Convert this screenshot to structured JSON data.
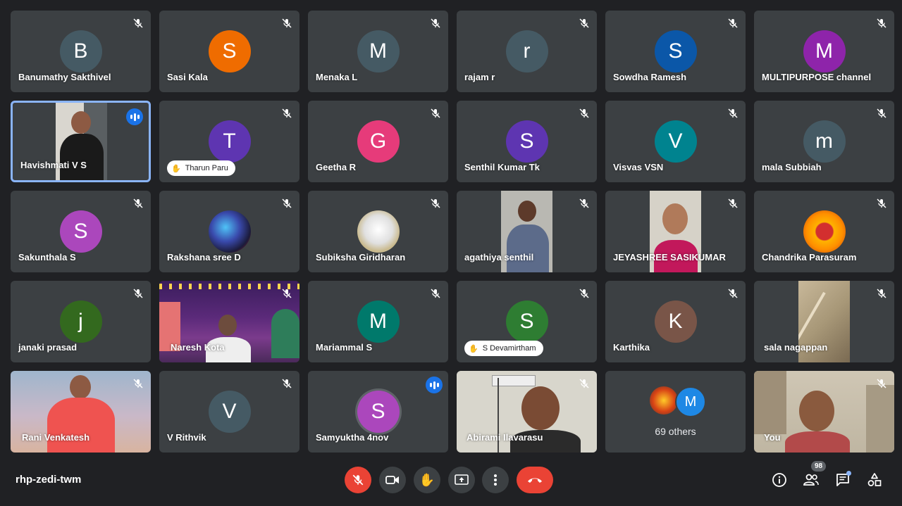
{
  "meeting": {
    "code": "rhp-zedi-twm"
  },
  "participants": [
    {
      "name": "Banumathy Sakthivel",
      "initial": "B",
      "color": "#455a64"
    },
    {
      "name": "Sasi Kala",
      "initial": "S",
      "color": "#ef6c00"
    },
    {
      "name": "Menaka L",
      "initial": "M",
      "color": "#455a64"
    },
    {
      "name": "rajam r",
      "initial": "r",
      "color": "#455a64"
    },
    {
      "name": "Sowdha Ramesh",
      "initial": "S",
      "color": "#0b57a8"
    },
    {
      "name": "MULTIPURPOSE channel",
      "initial": "M",
      "color": "#8e24aa"
    },
    {
      "name": "Havishmati V S",
      "initial": "",
      "color": ""
    },
    {
      "name": "Tharun Paru",
      "initial": "T",
      "color": "#5e35b1"
    },
    {
      "name": "Geetha R",
      "initial": "G",
      "color": "#e63b7a"
    },
    {
      "name": "Senthil Kumar Tk",
      "initial": "S",
      "color": "#5e35b1"
    },
    {
      "name": "Visvas VSN",
      "initial": "V",
      "color": "#00838f"
    },
    {
      "name": "mala Subbiah",
      "initial": "m",
      "color": "#455a64"
    },
    {
      "name": "Sakunthala S",
      "initial": "S",
      "color": "#ab47bc"
    },
    {
      "name": "Rakshana sree D",
      "initial": "",
      "color": ""
    },
    {
      "name": "Subiksha Giridharan",
      "initial": "",
      "color": ""
    },
    {
      "name": "agathiya senthil",
      "initial": "",
      "color": ""
    },
    {
      "name": "JEYASHREE SASIKUMAR",
      "initial": "",
      "color": ""
    },
    {
      "name": "Chandrika Parasuram",
      "initial": "",
      "color": ""
    },
    {
      "name": "janaki prasad",
      "initial": "j",
      "color": "#33691e"
    },
    {
      "name": "Naresh Kota",
      "initial": "",
      "color": ""
    },
    {
      "name": "Mariammal S",
      "initial": "M",
      "color": "#00796b"
    },
    {
      "name": "S Devamirtham",
      "initial": "S",
      "color": "#2e7d32"
    },
    {
      "name": "Karthika",
      "initial": "K",
      "color": "#795548"
    },
    {
      "name": "sala nagappan",
      "initial": "",
      "color": ""
    },
    {
      "name": "Rani Venkatesh",
      "initial": "",
      "color": ""
    },
    {
      "name": "V Rithvik",
      "initial": "V",
      "color": "#455a64"
    },
    {
      "name": "Samyuktha 4nov",
      "initial": "S",
      "color": "#ab47bc"
    },
    {
      "name": "Abirami Ilavarasu",
      "initial": "",
      "color": ""
    },
    {
      "name": "",
      "initial": "",
      "color": ""
    },
    {
      "name": "You",
      "initial": "",
      "color": ""
    }
  ],
  "others": {
    "label": "69 others",
    "initial": "M",
    "color": "#1e88e5"
  },
  "toolbar": {
    "participant_count": "98"
  },
  "colors": {
    "background": "#202124",
    "tile": "#3c4043",
    "accent": "#1a73e8",
    "danger": "#ea4335"
  }
}
